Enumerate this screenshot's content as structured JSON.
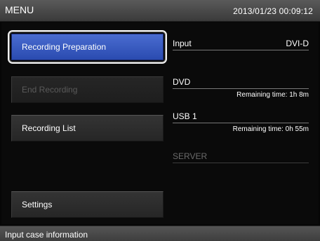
{
  "header": {
    "title": "MENU",
    "datetime": "2013/01/23  00:09:12"
  },
  "menu": {
    "recording_preparation": "Recording Preparation",
    "end_recording": "End Recording",
    "recording_list": "Recording List",
    "settings": "Settings"
  },
  "info": {
    "input": {
      "label": "Input",
      "value": "DVI-D"
    },
    "dvd": {
      "label": "DVD",
      "remaining": "Remaining time: 1h 8m"
    },
    "usb": {
      "label": "USB 1",
      "remaining": "Remaining time: 0h 55m"
    },
    "server": {
      "label": "SERVER"
    }
  },
  "status": {
    "message": "Input case information"
  },
  "colors": {
    "selected_button": "#3a5cc4",
    "header": "#4a4a4a",
    "background": "#0a0a0a"
  }
}
